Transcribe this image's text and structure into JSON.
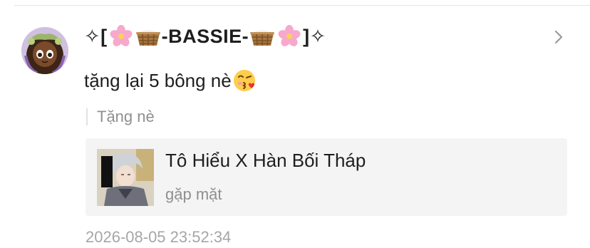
{
  "post": {
    "user": {
      "name_prefix": "✧[",
      "name_core": "-BASSIE-",
      "name_suffix": "]✧",
      "avatar_icon": "anime-girl-avatar"
    },
    "message": "tặng lại 5 bông nè",
    "message_emoji": "face-blowing-kiss-icon",
    "gift_label": "Tặng nè",
    "gift_card": {
      "title": "Tô Hiểu X Hàn Bối Tháp",
      "subtitle": "gặp mặt",
      "cover_icon": "anime-character-cover"
    },
    "timestamp": "2026-08-05 23:52:34"
  },
  "colors": {
    "text_primary": "#1e1e1e",
    "text_secondary": "#8f8f8f",
    "card_background": "#f4f4f4",
    "divider": "#e4e4e4"
  }
}
